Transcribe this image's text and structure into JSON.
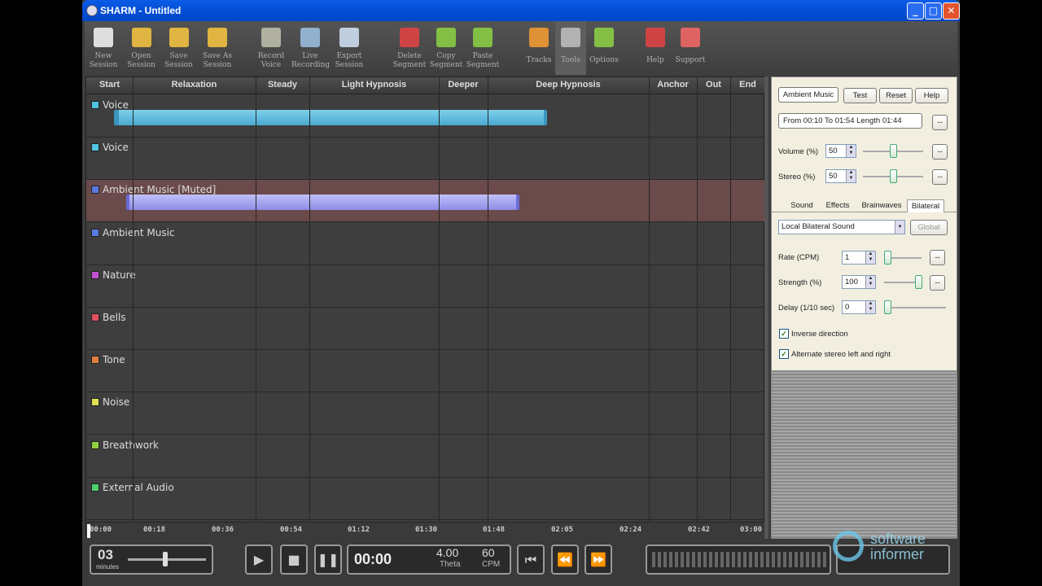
{
  "window": {
    "title": "SHARM - Untitled"
  },
  "toolbar": [
    {
      "key": "new",
      "label": "New\nSession",
      "icon": "new-document-icon"
    },
    {
      "key": "open",
      "label": "Open\nSession",
      "icon": "open-folder-icon"
    },
    {
      "key": "save",
      "label": "Save\nSession",
      "icon": "save-folder-icon"
    },
    {
      "key": "saveas",
      "label": "Save As\nSession",
      "icon": "save-as-icon"
    },
    {
      "key": "record",
      "label": "Record\nVoice",
      "icon": "microphone-icon"
    },
    {
      "key": "live",
      "label": "Live\nRecording",
      "icon": "live-recording-icon"
    },
    {
      "key": "export",
      "label": "Export\nSession",
      "icon": "export-disc-icon"
    },
    {
      "key": "delete",
      "label": "Delete\nSegment",
      "icon": "delete-segment-icon"
    },
    {
      "key": "copy",
      "label": "Copy\nSegment",
      "icon": "copy-segment-icon"
    },
    {
      "key": "paste",
      "label": "Paste\nSegment",
      "icon": "paste-segment-icon"
    },
    {
      "key": "tracks",
      "label": "Tracks",
      "icon": "tracks-icon"
    },
    {
      "key": "tools",
      "label": "Tools",
      "icon": "tools-icon"
    },
    {
      "key": "options",
      "label": "Options",
      "icon": "options-icon"
    },
    {
      "key": "help",
      "label": "Help",
      "icon": "help-book-icon"
    },
    {
      "key": "support",
      "label": "Support",
      "icon": "support-icon"
    }
  ],
  "phases": [
    "Start",
    "Relaxation",
    "Steady",
    "Light Hypnosis",
    "Deeper",
    "Deep Hypnosis",
    "Anchor",
    "Out",
    "End"
  ],
  "tracks": [
    {
      "label": "Voice",
      "color": "#4fc3e0"
    },
    {
      "label": "Voice",
      "color": "#4fc3e0"
    },
    {
      "label": "Ambient Music [Muted]",
      "color": "#5a7ae0"
    },
    {
      "label": "Ambient Music",
      "color": "#5a7ae0"
    },
    {
      "label": "Nature",
      "color": "#c050d0"
    },
    {
      "label": "Bells",
      "color": "#e05060"
    },
    {
      "label": "Tone",
      "color": "#e08040"
    },
    {
      "label": "Noise",
      "color": "#e0e050"
    },
    {
      "label": "Breathwork",
      "color": "#90d040"
    },
    {
      "label": "External Audio",
      "color": "#50d070"
    }
  ],
  "timeline": [
    "00:00",
    "00:18",
    "00:36",
    "00:54",
    "01:12",
    "01:30",
    "01:48",
    "02:05",
    "02:24",
    "02:42",
    "03:00"
  ],
  "panel": {
    "track_button": "Ambient Music",
    "test": "Test",
    "reset": "Reset",
    "help": "Help",
    "range_text": "From  00:10   To 01:54   Length 01:44",
    "more": "--",
    "volume_label": "Volume (%)",
    "volume_value": "50",
    "stereo_label": "Stereo (%)",
    "stereo_value": "50",
    "tabs": [
      "Sound",
      "Effects",
      "Brainwaves",
      "Bilateral"
    ],
    "select_value": "Local Bilateral Sound",
    "global": "Global",
    "rate_label": "Rate (CPM)",
    "rate_value": "1",
    "strength_label": "Strength (%)",
    "strength_value": "100",
    "delay_label": "Delay (1/10 sec)",
    "delay_value": "0",
    "inverse": "Inverse direction",
    "alternate": "Alternate stereo left and right"
  },
  "player": {
    "duration": "03",
    "duration_unit": "minutes",
    "time": "00:00",
    "freq": "4.00",
    "freq_label": "Theta",
    "cpm": "60",
    "cpm_label": "CPM"
  },
  "watermark": {
    "line1": "software",
    "line2": "informer"
  }
}
